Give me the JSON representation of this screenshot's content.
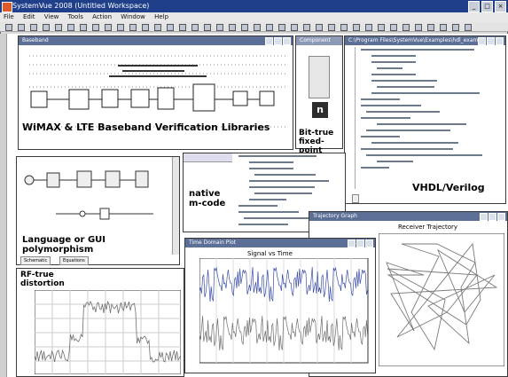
{
  "app": {
    "title": "SystemVue 2008 (Untitled Workspace)",
    "menu": [
      "File",
      "Edit",
      "View",
      "Tools",
      "Action",
      "Window",
      "Help"
    ]
  },
  "windows": {
    "baseband": {
      "title": "Baseband",
      "label": "WiMAX & LTE Baseband Verification Libraries"
    },
    "fixedpoint": {
      "title": "Component Gallery",
      "label": "Bit-true fixed-point"
    },
    "vhdl": {
      "title": "C:\\Program Files\\SystemVue\\Examples\\hdl_example.vhd",
      "label": "VHDL/Verilog"
    },
    "polymorphism": {
      "label": "Language or GUI polymorphism",
      "tab1": "Schematic",
      "tab2": "Equations"
    },
    "mcode": {
      "label": "native m-code"
    },
    "rf": {
      "label": "RF-true distortion"
    },
    "timeplot": {
      "title": "Time Domain Plot",
      "plot_title": "Signal vs Time"
    },
    "trajectory": {
      "title": "Trajectory Graph",
      "plot_title": "Receiver Trajectory"
    }
  },
  "colors": {
    "titlebar": "#1f3f8a",
    "window_title": "#5c6f96",
    "trace_blue": "#3b4fa8",
    "trace_gray": "#6f6f6f"
  },
  "icons": [
    "logo-icon",
    "minimize-icon",
    "maximize-icon",
    "close-icon"
  ]
}
